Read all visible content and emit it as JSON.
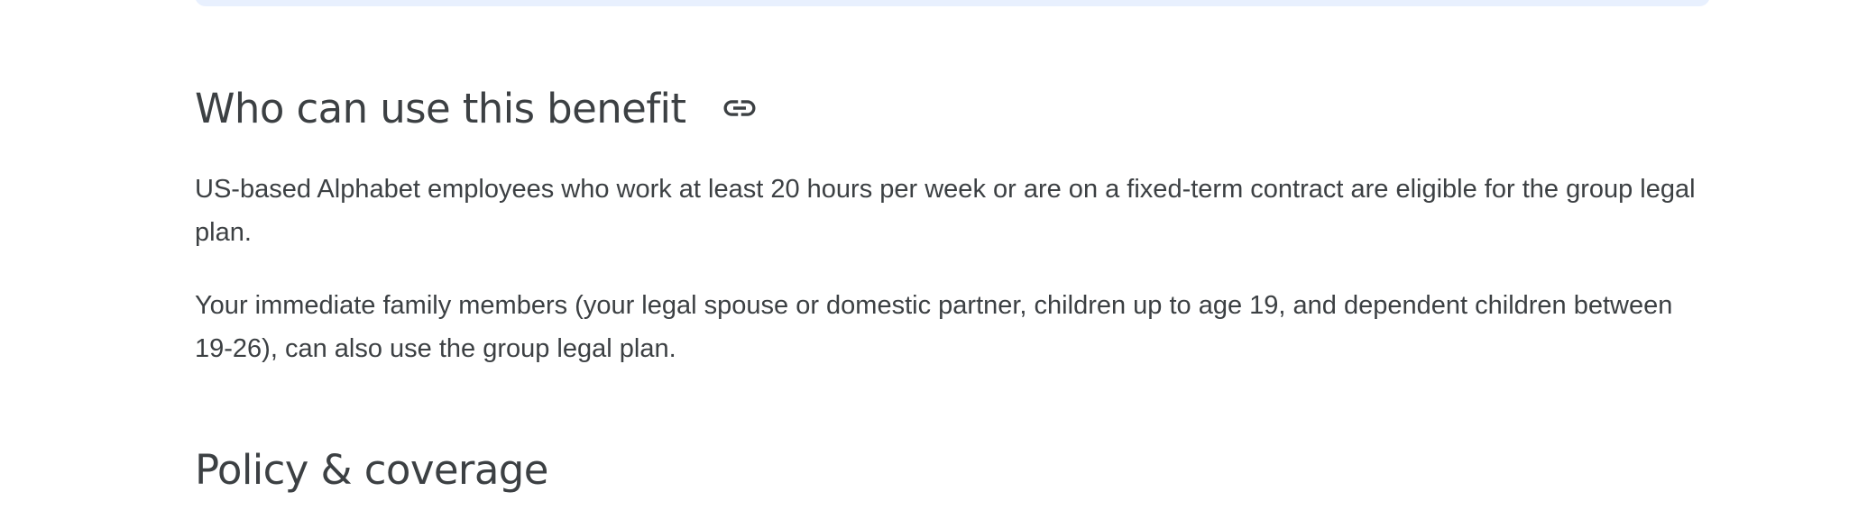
{
  "banner": {
    "color": "#e8f0fe"
  },
  "sections": [
    {
      "heading": "Who can use this benefit",
      "link_icon": "link-icon",
      "paragraphs": [
        "US-based Alphabet employees who work at least 20 hours per week or are on a fixed-term contract are eligible for the group legal plan.",
        "Your immediate family members (your legal spouse or domestic partner, children up to age 19, and dependent children between 19-26), can also use the group legal plan."
      ]
    },
    {
      "heading": "Policy & coverage"
    }
  ],
  "colors": {
    "text": "#3c4043",
    "background": "#ffffff"
  }
}
